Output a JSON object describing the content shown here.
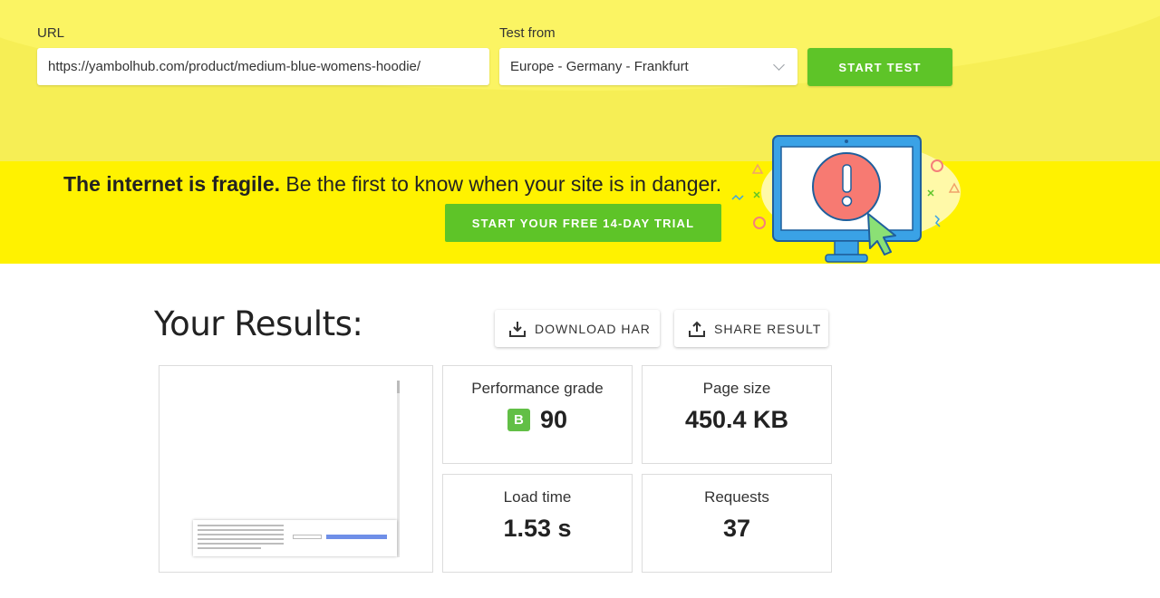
{
  "test_bar": {
    "url_label": "URL",
    "url_value": "https://yambolhub.com/product/medium-blue-womens-hoodie/",
    "location_label": "Test from",
    "location_value": "Europe - Germany - Frankfurt",
    "start_button": "START TEST"
  },
  "banner": {
    "headline_bold": "The internet is fragile.",
    "headline_rest": " Be the first to know when your site is in danger.",
    "cta": "START YOUR FREE 14-DAY TRIAL"
  },
  "results": {
    "title": "Your Results:",
    "download_button": "DOWNLOAD HAR",
    "share_button": "SHARE RESULT",
    "metrics": {
      "performance": {
        "label": "Performance grade",
        "grade": "B",
        "value": "90"
      },
      "page_size": {
        "label": "Page size",
        "value": "450.4 KB"
      },
      "load_time": {
        "label": "Load time",
        "value": "1.53 s"
      },
      "requests": {
        "label": "Requests",
        "value": "37"
      }
    }
  },
  "colors": {
    "accent_green": "#5ec428",
    "banner_yellow": "#fff200",
    "top_yellow": "#f6ee55",
    "grade_green": "#62bf46",
    "alert_red": "#f77a72",
    "monitor_blue": "#3aa2e6"
  },
  "icons": {
    "download": "download-icon",
    "share": "share-icon",
    "select_caret": "chevron-down-icon",
    "alert_monitor": "alert-monitor-illustration"
  }
}
